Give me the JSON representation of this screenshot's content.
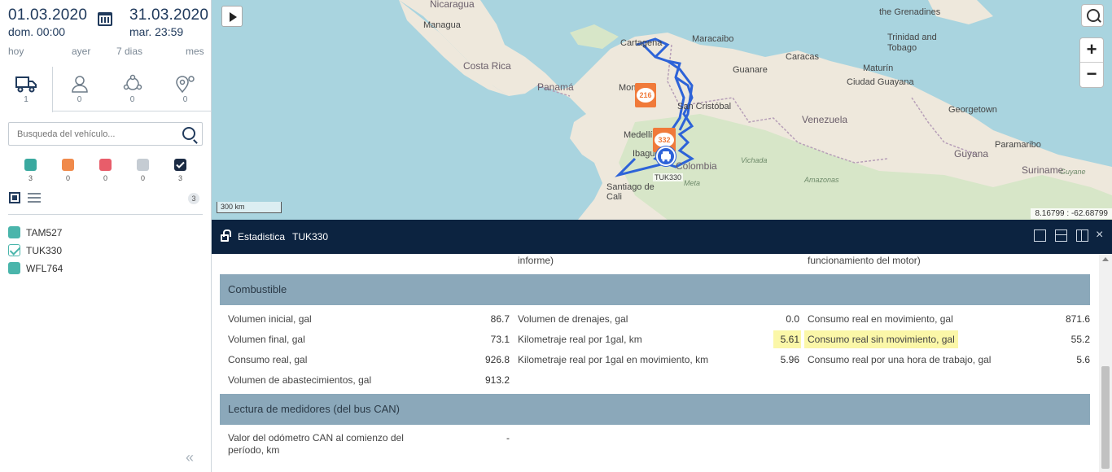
{
  "sidebar": {
    "from": {
      "date": "01.03.2020",
      "time": "dom. 00:00"
    },
    "to": {
      "date": "31.03.2020",
      "time": "mar. 23:59"
    },
    "quick_ranges": [
      "hoy",
      "ayer",
      "7 dias",
      "mes"
    ],
    "tabs": [
      {
        "name": "vehicles",
        "icon": "truck-icon",
        "count": "1"
      },
      {
        "name": "drivers",
        "icon": "user-icon",
        "count": "0"
      },
      {
        "name": "groups",
        "icon": "network-icon",
        "count": "0"
      },
      {
        "name": "geofences",
        "icon": "location-pin-icon",
        "count": "0"
      }
    ],
    "search_placeholder": "Busqueda del vehículo...",
    "status_filters": [
      {
        "color": "#3aa99f",
        "count": "3"
      },
      {
        "color": "#f08a4b",
        "count": "0"
      },
      {
        "color": "#e85d6a",
        "count": "0"
      },
      {
        "color": "#c5ccd3",
        "count": "0"
      },
      {
        "color": "#1b2b44",
        "count": "3",
        "checked": true
      }
    ],
    "list_count": "3",
    "vehicles": [
      {
        "name": "TAM527",
        "checked": false
      },
      {
        "name": "TUK330",
        "checked": true
      },
      {
        "name": "WFL764",
        "checked": false
      }
    ],
    "collapse_label": "«"
  },
  "map": {
    "scale": "300 km",
    "coords": "8.16799 : -62.68799",
    "zoom_in": "+",
    "zoom_out": "−",
    "labels": {
      "nicaragua": "Nicaragua",
      "managua": "Managua",
      "costa_rica": "Costa Rica",
      "panama": "Panamá",
      "cartagena": "Cartagena",
      "maracaibo": "Maracaibo",
      "caracas": "Caracas",
      "maturin": "Maturín",
      "guanare": "Guanare",
      "san_cristobal": "San Cristóbal",
      "ciudad_guayana": "Ciudad Guayana",
      "venezuela": "Venezuela",
      "georgetown": "Georgetown",
      "paramaribo": "Paramaribo",
      "guyana": "Guyana",
      "suriname": "Suriname",
      "guyane": "Guyane",
      "colombia": "Colombia",
      "ibague": "Ibagué",
      "medellin": "Medellín",
      "monteria": "Montería",
      "santiago_de_cali": "Santiago de Cali",
      "vichada": "Vichada",
      "meta": "Meta",
      "amazonas": "Amazonas",
      "trinidad": "Trinidad and Tobago",
      "grenadines": "the Grenadines"
    },
    "markers": [
      {
        "label": "216",
        "color": "#f07a3a"
      },
      {
        "label": "332",
        "color": "#f07a3a"
      }
    ],
    "vehicle_label": "TUK330"
  },
  "panel": {
    "title": "Estadistica",
    "vehicle": "TUK330",
    "close": "×",
    "truncated": {
      "left": "movimiento, hrs.min.seg.(% del período de informe)",
      "right": "carga, horas.min.seg.(% del tiempo de funcionamiento del motor)"
    },
    "fuel": {
      "title": "Combustible",
      "col1": [
        {
          "label": "Volumen inicial, gal",
          "value": "86.7"
        },
        {
          "label": "Volumen final, gal",
          "value": "73.1"
        },
        {
          "label": "Consumo real, gal",
          "value": "926.8"
        },
        {
          "label": "Volumen de abastecimientos, gal",
          "value": "913.2"
        }
      ],
      "col2": [
        {
          "label": "Volumen de drenajes, gal",
          "value": "0.0"
        },
        {
          "label": "Kilometraje real por 1gal, km",
          "value": "5.61"
        },
        {
          "label": "Kilometraje real por 1gal en movimiento, km",
          "value": "5.96"
        }
      ],
      "col3": [
        {
          "label": "Consumo real en movimiento, gal",
          "value": "871.6"
        },
        {
          "label": "Consumo real sin movimiento, gal",
          "value": "55.2"
        },
        {
          "label": "Consumo real por una hora de trabajo, gal",
          "value": "5.6"
        }
      ]
    },
    "can": {
      "title": "Lectura de medidores (del bus CAN)",
      "rows": [
        {
          "label": "Valor del odómetro CAN al comienzo del período, km",
          "value": "-"
        }
      ]
    }
  }
}
